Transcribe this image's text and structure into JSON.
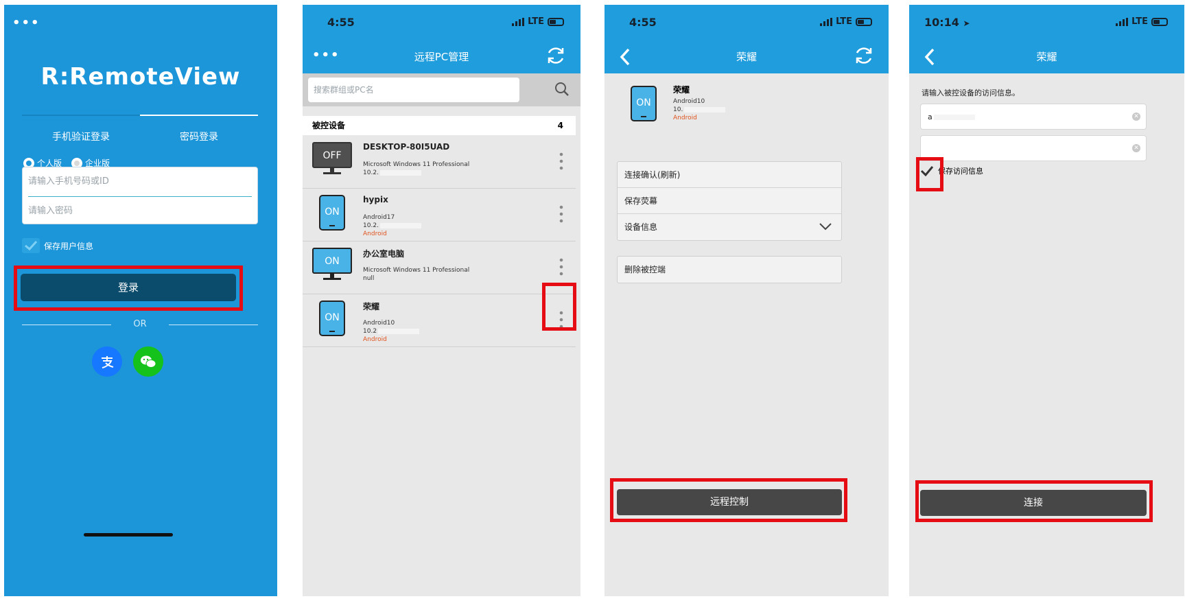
{
  "screen1": {
    "logo": "R:RemoteView",
    "tabs": [
      "手机验证登录",
      "密码登录"
    ],
    "radio_personal": "个人版",
    "radio_enterprise": "企业版",
    "phone_placeholder": "请输入手机号码或ID",
    "password_placeholder": "请输入密码",
    "save_user": "保存用户信息",
    "login_button": "登录",
    "or_text": "OR",
    "social": [
      "alipay-icon",
      "wechat-icon"
    ],
    "colors": {
      "bg": "#1d96d9",
      "button": "#0b4b6c"
    }
  },
  "screen2": {
    "time": "4:55",
    "network": "LTE",
    "title": "远程PC管理",
    "search_placeholder": "搜索群组或PC名",
    "section_title": "被控设备",
    "section_count": "4",
    "devices": [
      {
        "name": "DESKTOP-80I5UAD",
        "state": "OFF",
        "type": "monitor",
        "line1": "Microsoft Windows 11 Professional",
        "line2": "10.2.",
        "line3": ""
      },
      {
        "name": "hypix",
        "state": "ON",
        "type": "tablet",
        "line1": "Android17",
        "line2": "10.2.",
        "line3": "Android"
      },
      {
        "name": "办公室电脑",
        "state": "ON",
        "type": "monitor",
        "line1": "Microsoft Windows 11 Professional",
        "line2": "null",
        "line3": ""
      },
      {
        "name": "荣耀",
        "state": "ON",
        "type": "tablet",
        "line1": "Android10",
        "line2": "10.2",
        "line3": "Android"
      }
    ]
  },
  "screen3": {
    "time": "4:55",
    "network": "LTE",
    "title": "荣耀",
    "device_state": "ON",
    "device_name": "荣耀",
    "device_os": "Android10",
    "device_ip": "10.",
    "device_platform": "Android",
    "menu": [
      "连接确认(刷新)",
      "保存荧幕",
      "设备信息"
    ],
    "delete": "删除被控端",
    "remote_button": "远程控制"
  },
  "screen4": {
    "time": "10:14",
    "network": "LTE",
    "title": "荣耀",
    "prompt": "请输入被控设备的访问信息。",
    "input1_value": "a",
    "input2_value": "",
    "save_access": "保存访问信息",
    "connect_button": "连接"
  }
}
